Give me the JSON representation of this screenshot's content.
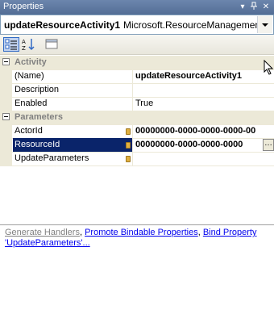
{
  "window": {
    "title": "Properties",
    "pin_icon": "pin-icon",
    "close_icon": "close-icon"
  },
  "object_selector": {
    "name": "updateResourceActivity1",
    "type": "Microsoft.ResourceManagement.W"
  },
  "toolbar": {
    "buttons": [
      "categorized-icon",
      "alphabetical-icon",
      "property-pages-icon"
    ]
  },
  "grid": {
    "categories": [
      {
        "label": "Activity",
        "properties": [
          {
            "name": "(Name)",
            "value": "updateResourceActivity1",
            "bold": true
          },
          {
            "name": "Description",
            "value": ""
          },
          {
            "name": "Enabled",
            "value": "True"
          }
        ]
      },
      {
        "label": "Parameters",
        "properties": [
          {
            "name": "ActorId",
            "value": "00000000-0000-0000-0000-00"
          },
          {
            "name": "ResourceId",
            "value": "00000000-0000-0000-0000"
          },
          {
            "name": "UpdateParameters",
            "value": ""
          }
        ]
      }
    ]
  },
  "commands": {
    "generate_handlers": "Generate Handlers",
    "sep1": ",",
    "promote_bindable": "Promote Bindable Properties",
    "sep2": ",",
    "bind_property": "Bind Property 'UpdateParameters'..."
  },
  "colors": {
    "titlebar": "#6c86ad",
    "selection": "#0a246a",
    "category_bg": "#ece9d8",
    "link": "#0000ee"
  }
}
